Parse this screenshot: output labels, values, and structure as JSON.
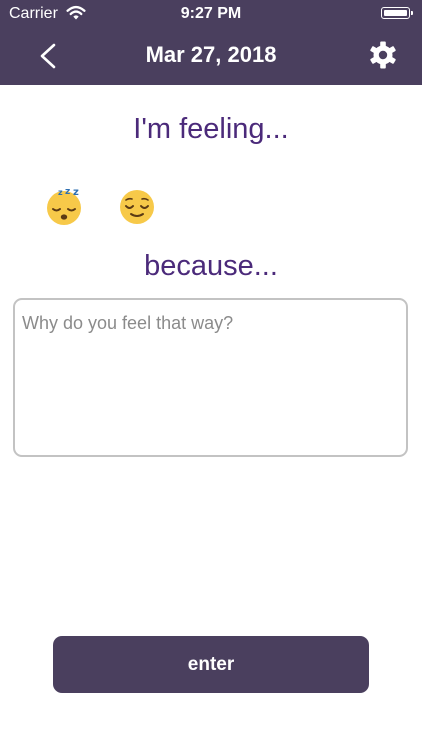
{
  "status_bar": {
    "carrier": "Carrier",
    "time": "9:27 PM",
    "wifi_icon": "wifi-icon",
    "battery_icon": "battery-full-icon"
  },
  "nav": {
    "back_icon": "chevron-left-icon",
    "title": "Mar 27, 2018",
    "settings_icon": "gear-icon"
  },
  "main": {
    "feeling_heading": "I'm feeling...",
    "emojis": [
      {
        "name": "sleeping-face-emoji",
        "symbol": "😴"
      },
      {
        "name": "relieved-face-emoji",
        "symbol": "😌"
      }
    ],
    "because_heading": "because...",
    "reason_input": {
      "value": "",
      "placeholder": "Why do you feel that way?"
    }
  },
  "footer": {
    "enter_label": "enter"
  },
  "colors": {
    "bar": "#4a3f5e",
    "heading_text": "#4b2a7a",
    "button": "#4a3f5e"
  }
}
